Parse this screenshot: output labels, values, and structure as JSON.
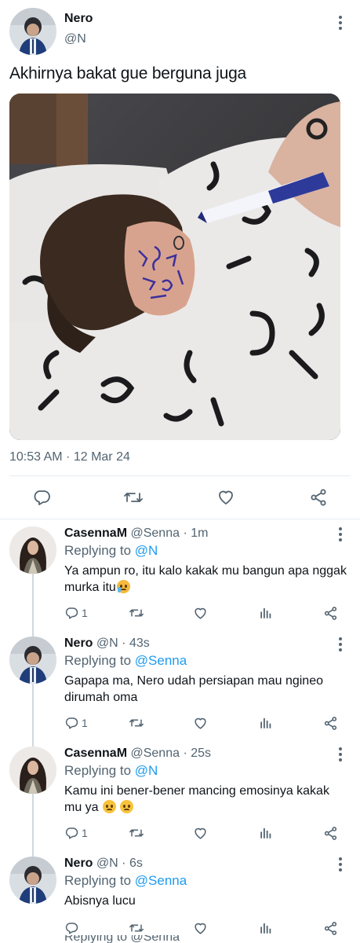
{
  "main_tweet": {
    "name": "Nero",
    "handle": "@N",
    "text": "Akhirnya bakat gue berguna juga",
    "timestamp": "10:53 AM · 12 Mar 24",
    "icons": [
      "more-vertical-icon",
      "reply-icon",
      "retweet-icon",
      "like-icon",
      "share-icon"
    ]
  },
  "replies": [
    {
      "name": "CasennaM",
      "handle": "@Senna",
      "time": "1m",
      "replying_prefix": "Replying to ",
      "replying_to": "@N",
      "text": "Ya ampun ro, itu kalo kakak mu bangun apa nggak murka itu",
      "emoji": "loudly-crying-face",
      "reply_count": "1",
      "avatar": "female"
    },
    {
      "name": "Nero",
      "handle": "@N",
      "time": "43s",
      "replying_prefix": "Replying to ",
      "replying_to": "@Senna",
      "text": "Gapapa ma, Nero udah persiapan mau ngineo dirumah oma",
      "reply_count": "1",
      "avatar": "male"
    },
    {
      "name": "CasennaM",
      "handle": "@Senna",
      "time": "25s",
      "replying_prefix": "Replying to ",
      "replying_to": "@N",
      "text": "Kamu ini bener-bener mancing emosinya kakak mu ya",
      "emoji": "frowning-face x2",
      "reply_count": "1",
      "avatar": "female"
    },
    {
      "name": "Nero",
      "handle": "@N",
      "time": "6s",
      "replying_prefix": "Replying to ",
      "replying_to": "@Senna",
      "text": "Abisnya lucu",
      "reply_count": "",
      "avatar": "male"
    }
  ],
  "peek": {
    "text": "Replying to @Senna"
  },
  "colors": {
    "text": "#0f1419",
    "secondary": "#536471",
    "link": "#1d9bf0",
    "divider": "#e6ecf0"
  }
}
